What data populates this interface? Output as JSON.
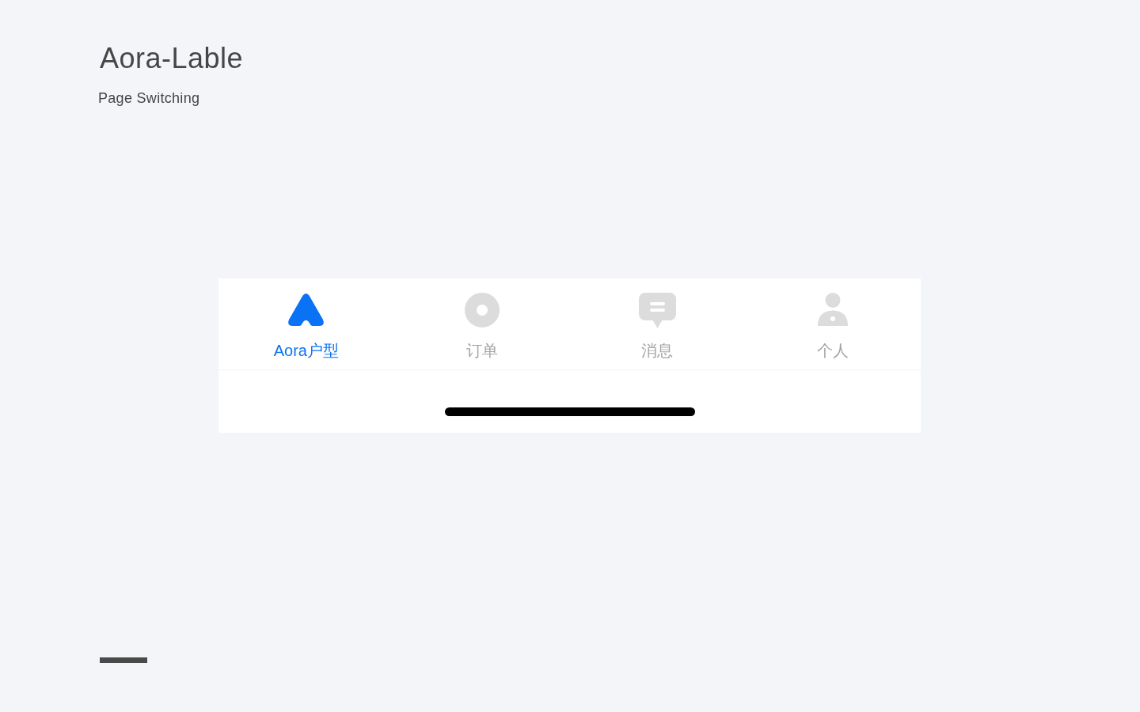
{
  "header": {
    "title": "Aora-Lable",
    "subtitle": "Page Switching"
  },
  "tab_bar": {
    "tabs": [
      {
        "label": "Aora户型",
        "kind": "logo",
        "selected": true
      },
      {
        "label": "订单",
        "kind": "ring",
        "selected": false
      },
      {
        "label": "消息",
        "kind": "chat",
        "selected": false
      },
      {
        "label": "个人",
        "kind": "person",
        "selected": false
      }
    ]
  }
}
